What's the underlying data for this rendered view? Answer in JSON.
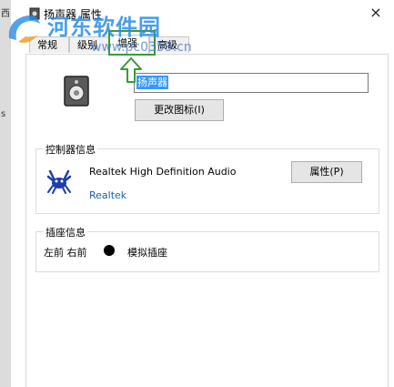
{
  "window": {
    "title": "扬声器 属性",
    "close_glyph": "×"
  },
  "left_strip": {
    "fragment_1": "西",
    "fragment_2": "s"
  },
  "tabs": [
    {
      "label": "常规"
    },
    {
      "label": "级别"
    },
    {
      "label": "增强"
    },
    {
      "label": "高级"
    }
  ],
  "device": {
    "name": "扬声器",
    "change_icon_label": "更改图标(I)"
  },
  "controller": {
    "group_label": "控制器信息",
    "name": "Realtek High Definition Audio",
    "vendor": "Realtek",
    "properties_label": "属性(P)"
  },
  "jack": {
    "group_label": "插座信息",
    "location": "左前 右前",
    "type": "模拟插座",
    "dot_color": "#000000"
  },
  "watermark": {
    "site_name": "河东软件园",
    "url": "www.pc0359.cn"
  },
  "colors": {
    "highlight": "#3a9a3a",
    "selection": "#3399ff",
    "link": "#1a5fb4"
  }
}
